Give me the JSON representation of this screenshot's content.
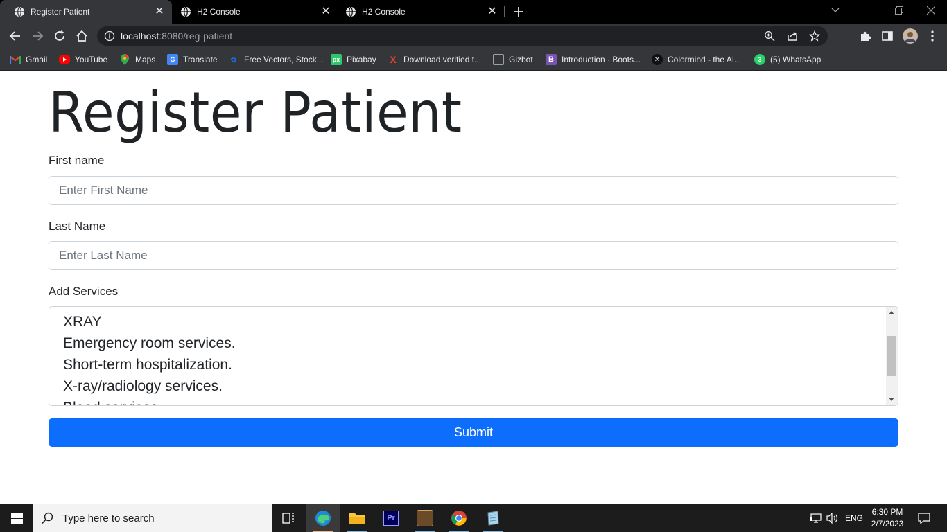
{
  "browser": {
    "tabs": [
      {
        "title": "Register Patient",
        "active": true
      },
      {
        "title": "H2 Console",
        "active": false
      },
      {
        "title": "H2 Console",
        "active": false
      }
    ],
    "address": {
      "host": "localhost",
      "path": ":8080/reg-patient"
    },
    "bookmarks": [
      {
        "label": "Gmail",
        "icon": "gmail-icon"
      },
      {
        "label": "YouTube",
        "icon": "youtube-icon"
      },
      {
        "label": "Maps",
        "icon": "maps-icon"
      },
      {
        "label": "Translate",
        "icon": "translate-icon"
      },
      {
        "label": "Free Vectors, Stock...",
        "icon": "freepik-icon"
      },
      {
        "label": "Pixabay",
        "icon": "pixabay-icon"
      },
      {
        "label": "Download verified t...",
        "icon": "x-icon"
      },
      {
        "label": "Gizbot",
        "icon": "gizbot-icon"
      },
      {
        "label": "Introduction · Boots...",
        "icon": "bootstrap-icon"
      },
      {
        "label": "Colormind - the AI...",
        "icon": "colormind-icon"
      },
      {
        "label": "(5) WhatsApp",
        "icon": "whatsapp-icon"
      }
    ]
  },
  "form": {
    "title": "Register Patient",
    "first_name": {
      "label": "First name",
      "placeholder": "Enter First Name"
    },
    "last_name": {
      "label": "Last Name",
      "placeholder": "Enter Last Name"
    },
    "services": {
      "label": "Add Services",
      "options": [
        "XRAY",
        "Emergency room services.",
        "Short-term hospitalization.",
        "X-ray/radiology services.",
        "Blood services"
      ]
    },
    "submit_label": "Submit"
  },
  "taskbar": {
    "search_placeholder": "Type here to search",
    "language": "ENG",
    "time": "6:30 PM",
    "date": "2/7/2023"
  },
  "colors": {
    "primary": "#0d6efd",
    "chrome_dark": "#35363a",
    "tabbar": "#000000"
  }
}
